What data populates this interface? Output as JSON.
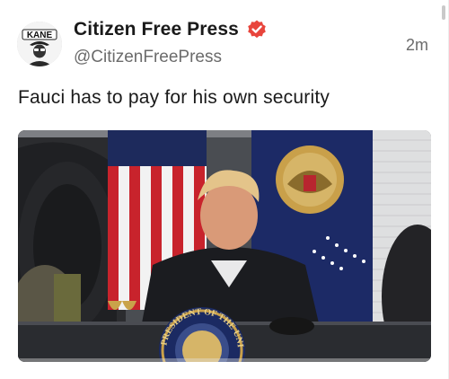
{
  "post": {
    "display_name": "Citizen Free Press",
    "handle": "@CitizenFreePress",
    "timestamp": "2m",
    "text": "Fauci has to pay for his own security",
    "avatar": {
      "label": "KANE"
    },
    "verified_icon": "verified-badge-icon",
    "verified_color": "#e8453c",
    "media": {
      "seal_text": "PRESIDENT OF THE UNITED"
    }
  },
  "colors": {
    "name": "#1a1a1a",
    "secondary": "#6b6b6b"
  }
}
